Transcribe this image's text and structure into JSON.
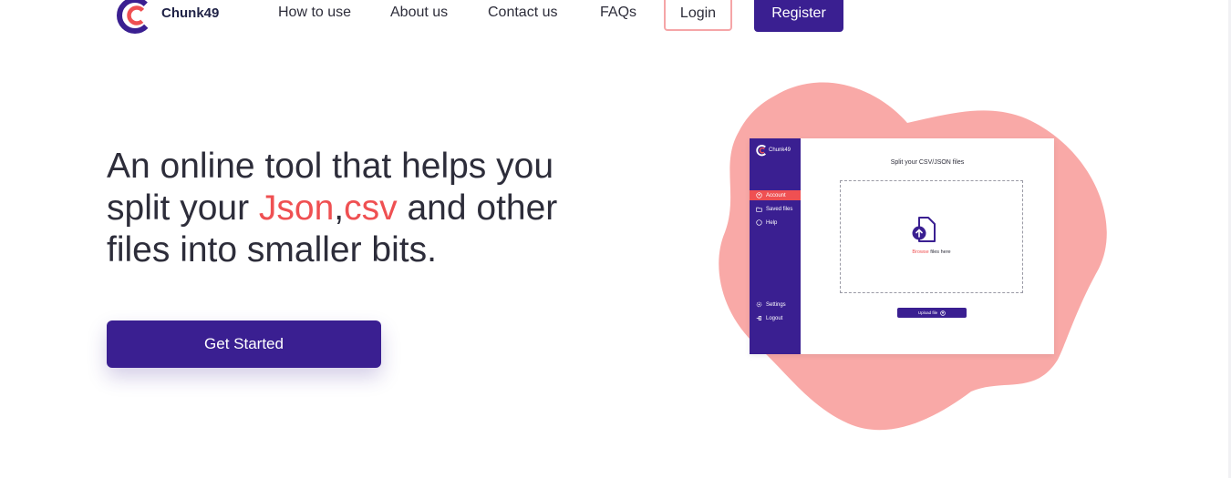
{
  "nav": {
    "brand": "Chunk49",
    "links": [
      "How to use",
      "About us",
      "Contact us",
      "FAQs"
    ],
    "login_label": "Login",
    "register_label": "Register"
  },
  "hero": {
    "line1": "An online tool that helps you",
    "line2_pre": "split your ",
    "accent_json": "Json",
    "comma": ",",
    "accent_csv": "csv",
    "line2_post": " and other",
    "line3": "files into smaller bits.",
    "cta_label": "Get Started"
  },
  "illustration": {
    "brand": "Chunk49",
    "sidebar_items": [
      "Account",
      "Saved files",
      "Help"
    ],
    "sidebar_bottom_items": [
      "Settings",
      "Logout"
    ],
    "title": "Split your CSV/JSON files",
    "browse_link": "Browse",
    "browse_text": " files here",
    "upload_label": "Upload file"
  },
  "colors": {
    "primary": "#3a1f91",
    "accent": "#ef5052",
    "blob": "#f9a9a7",
    "login_border": "#f5a5a7"
  }
}
